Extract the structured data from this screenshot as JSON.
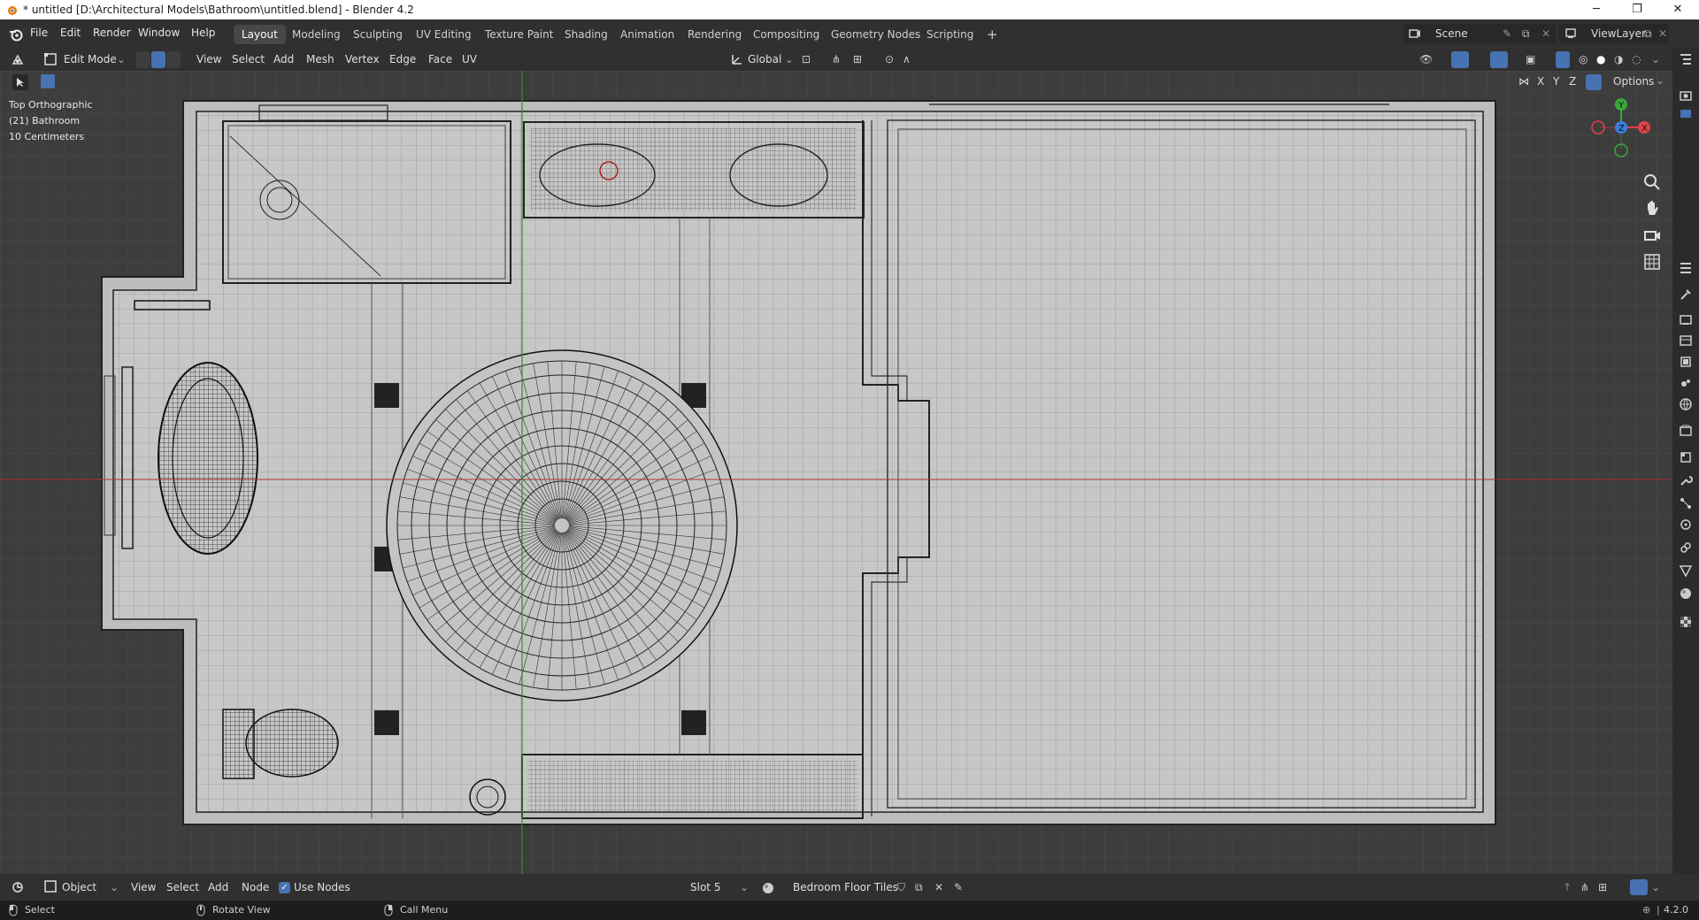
{
  "window": {
    "title": "* untitled [D:\\Architectural Models\\Bathroom\\untitled.blend] - Blender 4.2",
    "minimize": "─",
    "restore": "❐",
    "close": "✕"
  },
  "menu": [
    "File",
    "Edit",
    "Render",
    "Window",
    "Help"
  ],
  "workspaces": [
    {
      "label": "Layout",
      "active": true
    },
    {
      "label": "Modeling"
    },
    {
      "label": "Sculpting"
    },
    {
      "label": "UV Editing"
    },
    {
      "label": "Texture Paint"
    },
    {
      "label": "Shading"
    },
    {
      "label": "Animation"
    },
    {
      "label": "Rendering"
    },
    {
      "label": "Compositing"
    },
    {
      "label": "Geometry Nodes"
    },
    {
      "label": "Scripting"
    }
  ],
  "add_workspace": "+",
  "scene": {
    "label": "Scene"
  },
  "viewlayer": {
    "label": "ViewLayer"
  },
  "header": {
    "mode": "Edit Mode",
    "menus": [
      "View",
      "Select",
      "Add",
      "Mesh",
      "Vertex",
      "Edge",
      "Face",
      "UV"
    ],
    "orientation": "Global"
  },
  "toolrow": {
    "axes": [
      "X",
      "Y",
      "Z"
    ],
    "options": "Options"
  },
  "viewport": {
    "view_name": "Top Orthographic",
    "collection": "(21) Bathroom",
    "scale": "10 Centimeters"
  },
  "gizmo": {
    "x": "X",
    "y": "Y",
    "z": "Z"
  },
  "bottom": {
    "object": "Object",
    "menus": [
      "View",
      "Select",
      "Add",
      "Node"
    ],
    "use_nodes": "Use Nodes",
    "slot": "Slot 5",
    "material": "Bedroom Floor Tiles"
  },
  "status": {
    "select": "Select",
    "rotate": "Rotate View",
    "call_menu": "Call Menu",
    "version": "4.2.0"
  },
  "colors": {
    "accent": "#4772b3",
    "x_axis": "#e0414d",
    "y_axis": "#3aa63a",
    "z_axis": "#3c7de0"
  }
}
